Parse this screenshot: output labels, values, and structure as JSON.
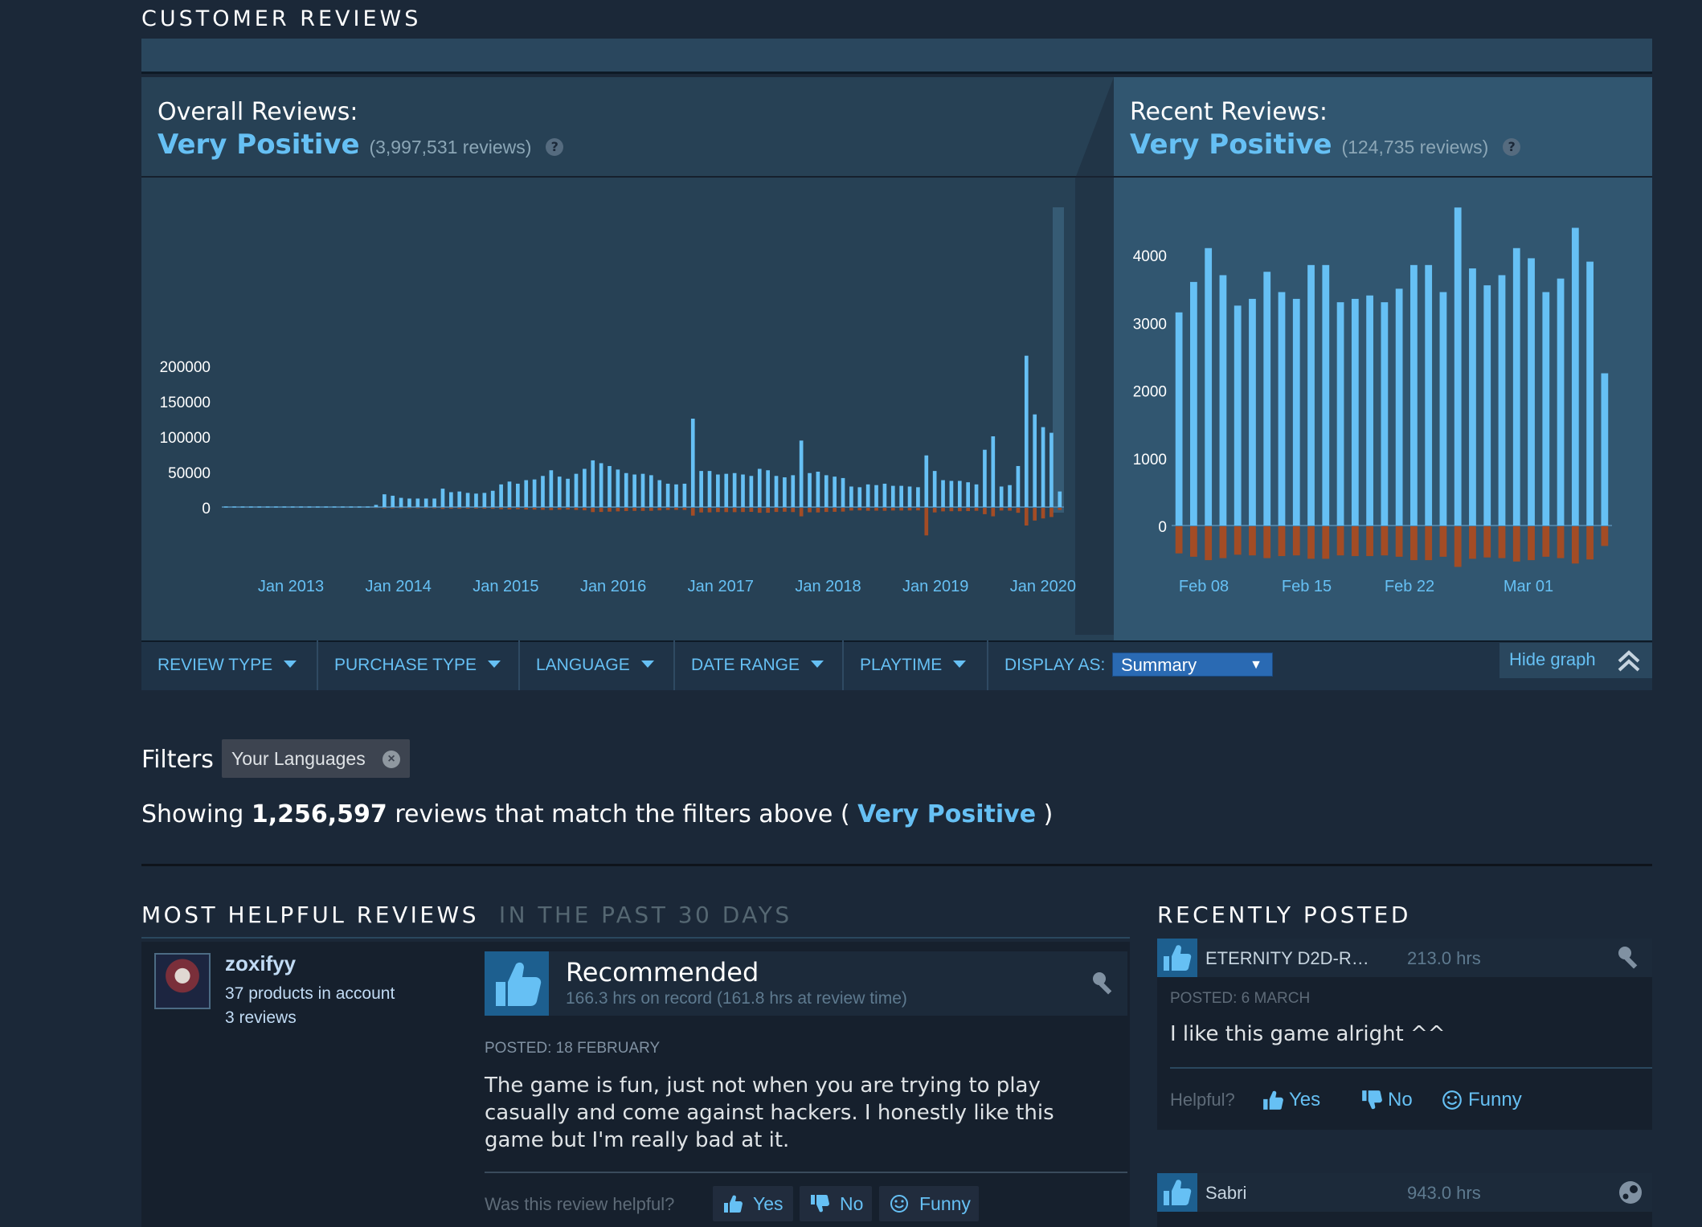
{
  "section_title": "CUSTOMER REVIEWS",
  "overall": {
    "label": "Overall Reviews:",
    "summary": "Very Positive",
    "count": "(3,997,531 reviews)"
  },
  "recent": {
    "label": "Recent Reviews:",
    "summary": "Very Positive",
    "count": "(124,735 reviews)"
  },
  "chart_data": [
    {
      "type": "bar",
      "y_ticks": [
        "200000",
        "150000",
        "100000",
        "50000",
        "0"
      ],
      "y_tick_values": [
        200000,
        150000,
        100000,
        50000,
        0
      ],
      "x_ticks": [
        "Jan 2013",
        "Jan 2014",
        "Jan 2015",
        "Jan 2016",
        "Jan 2017",
        "Jan 2018",
        "Jan 2019",
        "Jan 2020"
      ],
      "ylim": [
        -45000,
        215000
      ],
      "series": [
        {
          "values": [
            600,
            600,
            600,
            600,
            600,
            600,
            600,
            600,
            600,
            600,
            600,
            600,
            600,
            600,
            600,
            600,
            600,
            600,
            3000,
            18000,
            16000,
            13000,
            12000,
            12000,
            12000,
            12000,
            26000,
            21000,
            22000,
            20000,
            19000,
            20000,
            23000,
            32000,
            36000,
            33000,
            38000,
            39000,
            44000,
            52000,
            43000,
            40000,
            47000,
            54000,
            66000,
            62000,
            58000,
            53000,
            48000,
            46000,
            47000,
            45000,
            38000,
            33000,
            32000,
            33000,
            125000,
            51000,
            51000,
            46000,
            47000,
            48000,
            46000,
            44000,
            54000,
            52000,
            44000,
            42000,
            45000,
            94000,
            48000,
            50000,
            45000,
            43000,
            41000,
            29000,
            28000,
            32000,
            31000,
            33000,
            30000,
            30000,
            29000,
            28000,
            73000,
            51000,
            38000,
            37000,
            37000,
            35000,
            32000,
            81000,
            100000,
            29000,
            31000,
            58000,
            214000,
            131000,
            113000,
            105000,
            22000
          ]
        },
        {
          "values": [
            0,
            0,
            0,
            0,
            0,
            0,
            0,
            0,
            0,
            0,
            0,
            0,
            0,
            0,
            0,
            0,
            0,
            0,
            300,
            800,
            800,
            700,
            700,
            700,
            700,
            700,
            1500,
            1200,
            1300,
            1200,
            1100,
            1200,
            1300,
            2000,
            2300,
            2000,
            2400,
            2500,
            2800,
            3200,
            2700,
            2500,
            3000,
            3500,
            6000,
            5800,
            5400,
            5000,
            4500,
            4300,
            4300,
            4200,
            3600,
            3000,
            2900,
            3000,
            11000,
            6500,
            6400,
            6000,
            6000,
            6100,
            5900,
            5700,
            7000,
            6900,
            5800,
            5500,
            6000,
            12000,
            6300,
            6500,
            5800,
            5600,
            5300,
            3800,
            3600,
            4100,
            4000,
            4200,
            3800,
            3800,
            3700,
            3600,
            39000,
            6500,
            5000,
            4800,
            4800,
            4600,
            4200,
            9000,
            12000,
            3800,
            4000,
            7000,
            25000,
            18000,
            15000,
            13000,
            3000
          ]
        }
      ]
    },
    {
      "type": "bar",
      "y_ticks": [
        "4000",
        "3000",
        "2000",
        "1000",
        "0"
      ],
      "y_tick_values": [
        4000,
        3000,
        2000,
        1000,
        0
      ],
      "x_ticks": [
        "Feb 08",
        "Feb 15",
        "Feb 22",
        "Mar 01"
      ],
      "ylim": [
        -800,
        4700
      ],
      "series": [
        {
          "values": [
            3150,
            3600,
            4100,
            3700,
            3250,
            3350,
            3750,
            3450,
            3350,
            3850,
            3850,
            3300,
            3350,
            3400,
            3300,
            3500,
            3850,
            3850,
            3450,
            4700,
            3800,
            3550,
            3700,
            4100,
            3950,
            3450,
            3650,
            4400,
            3900,
            2250
          ]
        },
        {
          "values": [
            400,
            450,
            500,
            470,
            420,
            430,
            470,
            440,
            430,
            480,
            480,
            430,
            440,
            440,
            430,
            450,
            500,
            500,
            450,
            600,
            480,
            460,
            470,
            520,
            500,
            450,
            470,
            550,
            490,
            290
          ]
        }
      ]
    }
  ],
  "filters_bar": {
    "review_type": "REVIEW TYPE",
    "purchase_type": "PURCHASE TYPE",
    "language": "LANGUAGE",
    "date_range": "DATE RANGE",
    "playtime": "PLAYTIME",
    "display_as": "DISPLAY AS:",
    "display_value": "Summary",
    "hide_graph": "Hide graph"
  },
  "filters": {
    "label": "Filters",
    "chip": "Your Languages",
    "showing_pre": "Showing ",
    "showing_count": "1,256,597",
    "showing_mid": " reviews that match the filters above ( ",
    "showing_summary": "Very Positive",
    "showing_post": " )"
  },
  "most_helpful": {
    "title": "MOST HELPFUL REVIEWS",
    "subtitle": "IN THE PAST 30 DAYS"
  },
  "review": {
    "username": "zoxifyy",
    "products": "37 products in account",
    "reviews": "3 reviews",
    "verdict": "Recommended",
    "hours": "166.3 hrs on record (161.8 hrs at review time)",
    "posted": "POSTED: 18 FEBRUARY",
    "text": "The game is fun, just not when you are trying to play casually and come against hackers. I honestly like this game but I'm really bad at it.",
    "helpful_q": "Was this review helpful?",
    "yes": "Yes",
    "no": "No",
    "funny": "Funny"
  },
  "recently_posted": {
    "title": "RECENTLY POSTED",
    "items": [
      {
        "name": "ETERNITY D2D-R…",
        "hours": "213.0 hrs",
        "posted": "POSTED: 6 MARCH",
        "text": "I like this game alright ^^",
        "helpful_q": "Helpful?",
        "yes": "Yes",
        "no": "No",
        "funny": "Funny"
      },
      {
        "name": "Sabri",
        "hours": "943.0 hrs"
      }
    ]
  },
  "colors": {
    "positive": "#66c0f4",
    "negative": "#a34c25",
    "accent": "#66c0f4"
  }
}
